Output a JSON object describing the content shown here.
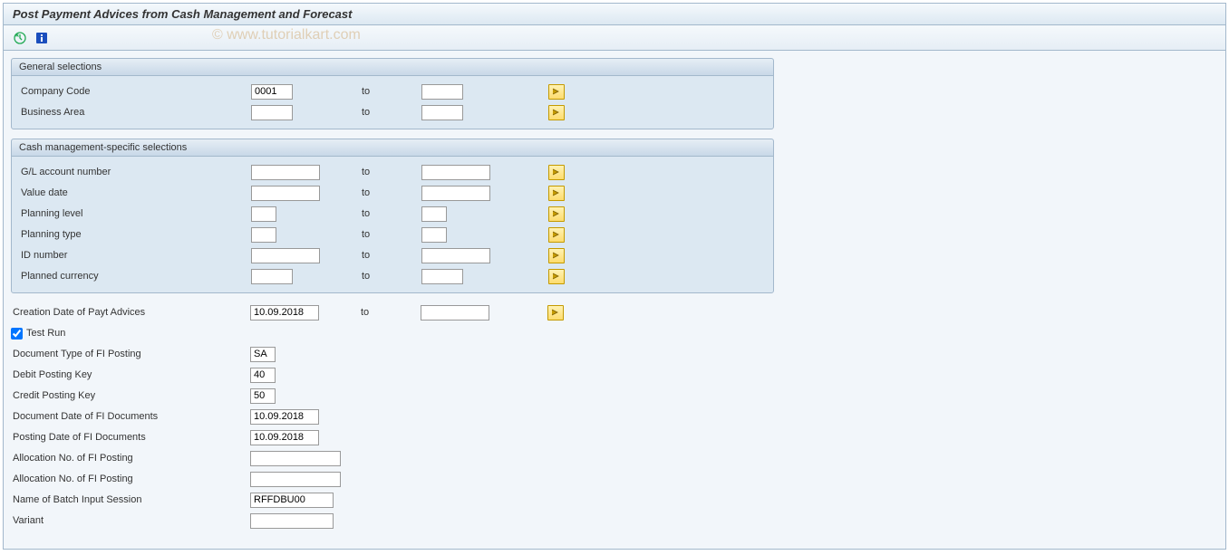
{
  "title": "Post Payment Advices from Cash Management and Forecast",
  "watermark": "© www.tutorialkart.com",
  "groups": {
    "general": {
      "header": "General selections",
      "company_code_label": "Company Code",
      "company_code_from": "0001",
      "company_code_to": "",
      "business_area_label": "Business Area",
      "business_area_from": "",
      "business_area_to": ""
    },
    "cash": {
      "header": "Cash management-specific selections",
      "gl_label": "G/L account number",
      "gl_from": "",
      "gl_to": "",
      "value_date_label": "Value date",
      "value_date_from": "",
      "value_date_to": "",
      "planning_level_label": "Planning level",
      "planning_level_from": "",
      "planning_level_to": "",
      "planning_type_label": "Planning type",
      "planning_type_from": "",
      "planning_type_to": "",
      "id_label": "ID number",
      "id_from": "",
      "id_to": "",
      "planned_currency_label": "Planned currency",
      "planned_currency_from": "",
      "planned_currency_to": ""
    }
  },
  "to_label": "to",
  "rows": {
    "creation_date_label": "Creation Date of Payt Advices",
    "creation_date_from": "10.09.2018",
    "creation_date_to": "",
    "test_run_label": "Test Run",
    "test_run_checked": true,
    "doc_type_label": "Document Type of FI Posting",
    "doc_type_value": "SA",
    "debit_key_label": "Debit Posting Key",
    "debit_key_value": "40",
    "credit_key_label": "Credit Posting Key",
    "credit_key_value": "50",
    "doc_date_label": "Document Date of FI Documents",
    "doc_date_value": "10.09.2018",
    "posting_date_label": "Posting Date of FI Documents",
    "posting_date_value": "10.09.2018",
    "alloc_no1_label": "Allocation No. of FI Posting",
    "alloc_no1_value": "",
    "alloc_no2_label": "Allocation No. of FI Posting",
    "alloc_no2_value": "",
    "batch_label": "Name of Batch Input Session",
    "batch_value": "RFFDBU00",
    "variant_label": "Variant",
    "variant_value": ""
  }
}
